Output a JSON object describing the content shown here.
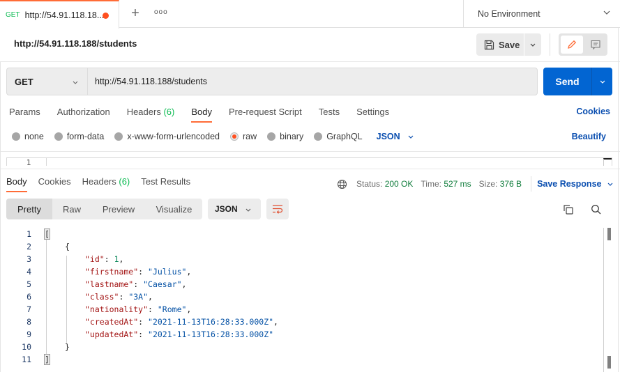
{
  "tabbar": {
    "active_tab": {
      "method": "GET",
      "title": "http://54.91.118.18...",
      "unsaved": true
    },
    "add_tab_icon": "plus-icon",
    "more_icon": "ellipsis-icon",
    "environment": "No Environment"
  },
  "request": {
    "name": "http://54.91.118.188/students",
    "save_label": "Save",
    "method": "GET",
    "url": "http://54.91.118.188/students",
    "send_label": "Send",
    "tabs": [
      {
        "label": "Params"
      },
      {
        "label": "Authorization"
      },
      {
        "label": "Headers",
        "count": "(6)"
      },
      {
        "label": "Body",
        "active": true
      },
      {
        "label": "Pre-request Script"
      },
      {
        "label": "Tests"
      },
      {
        "label": "Settings"
      }
    ],
    "cookies_label": "Cookies",
    "body_types": [
      "none",
      "form-data",
      "x-www-form-urlencoded",
      "raw",
      "binary",
      "GraphQL"
    ],
    "selected_body_type": "raw",
    "raw_language": "JSON",
    "beautify_label": "Beautify",
    "editor_first_line": "1"
  },
  "response": {
    "tabs": [
      {
        "label": "Body",
        "active": true
      },
      {
        "label": "Cookies"
      },
      {
        "label": "Headers",
        "count": "(6)"
      },
      {
        "label": "Test Results"
      }
    ],
    "status_label": "Status:",
    "status_value": "200 OK",
    "time_label": "Time:",
    "time_value": "527 ms",
    "size_label": "Size:",
    "size_value": "376 B",
    "save_response_label": "Save Response",
    "views": [
      "Pretty",
      "Raw",
      "Preview",
      "Visualize"
    ],
    "active_view": "Pretty",
    "format": "JSON",
    "code_lines": [
      {
        "n": "1",
        "indent": 0,
        "tokens": [
          {
            "t": "[",
            "c": "bracket"
          }
        ]
      },
      {
        "n": "2",
        "indent": 1,
        "tokens": [
          {
            "t": "{",
            "c": ""
          }
        ]
      },
      {
        "n": "3",
        "indent": 2,
        "tokens": [
          {
            "t": "\"id\"",
            "c": "key"
          },
          {
            "t": ": ",
            "c": ""
          },
          {
            "t": "1",
            "c": "num"
          },
          {
            "t": ",",
            "c": ""
          }
        ]
      },
      {
        "n": "4",
        "indent": 2,
        "tokens": [
          {
            "t": "\"firstname\"",
            "c": "key"
          },
          {
            "t": ": ",
            "c": ""
          },
          {
            "t": "\"Julius\"",
            "c": "str"
          },
          {
            "t": ",",
            "c": ""
          }
        ]
      },
      {
        "n": "5",
        "indent": 2,
        "tokens": [
          {
            "t": "\"lastname\"",
            "c": "key"
          },
          {
            "t": ": ",
            "c": ""
          },
          {
            "t": "\"Caesar\"",
            "c": "str"
          },
          {
            "t": ",",
            "c": ""
          }
        ]
      },
      {
        "n": "6",
        "indent": 2,
        "tokens": [
          {
            "t": "\"class\"",
            "c": "key"
          },
          {
            "t": ": ",
            "c": ""
          },
          {
            "t": "\"3A\"",
            "c": "str"
          },
          {
            "t": ",",
            "c": ""
          }
        ]
      },
      {
        "n": "7",
        "indent": 2,
        "tokens": [
          {
            "t": "\"nationality\"",
            "c": "key"
          },
          {
            "t": ": ",
            "c": ""
          },
          {
            "t": "\"Rome\"",
            "c": "str"
          },
          {
            "t": ",",
            "c": ""
          }
        ]
      },
      {
        "n": "8",
        "indent": 2,
        "tokens": [
          {
            "t": "\"createdAt\"",
            "c": "key"
          },
          {
            "t": ": ",
            "c": ""
          },
          {
            "t": "\"2021-11-13T16:28:33.000Z\"",
            "c": "str"
          },
          {
            "t": ",",
            "c": ""
          }
        ]
      },
      {
        "n": "9",
        "indent": 2,
        "tokens": [
          {
            "t": "\"updatedAt\"",
            "c": "key"
          },
          {
            "t": ": ",
            "c": ""
          },
          {
            "t": "\"2021-11-13T16:28:33.000Z\"",
            "c": "str"
          }
        ]
      },
      {
        "n": "10",
        "indent": 1,
        "tokens": [
          {
            "t": "}",
            "c": ""
          }
        ]
      },
      {
        "n": "11",
        "indent": 0,
        "tokens": [
          {
            "t": "]",
            "c": "bracket"
          }
        ]
      }
    ]
  },
  "colors": {
    "accent": "#ff6c37",
    "primary": "#0265d2",
    "link": "#0b4fb0",
    "success": "#0f7c3b"
  }
}
